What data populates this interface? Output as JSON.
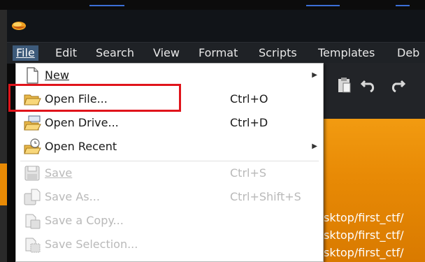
{
  "menubar": {
    "items": [
      {
        "label": "File",
        "active": true
      },
      {
        "label": "Edit"
      },
      {
        "label": "Search"
      },
      {
        "label": "View"
      },
      {
        "label": "Format"
      },
      {
        "label": "Scripts"
      },
      {
        "label": "Templates"
      },
      {
        "label": "Deb"
      }
    ]
  },
  "file_menu": {
    "items": [
      {
        "label": "New",
        "shortcut": "",
        "submenu": true,
        "enabled": true,
        "icon": "new-file-icon"
      },
      {
        "label": "Open File...",
        "shortcut": "Ctrl+O",
        "submenu": false,
        "enabled": true,
        "icon": "open-folder-icon"
      },
      {
        "label": "Open Drive...",
        "shortcut": "Ctrl+D",
        "submenu": false,
        "enabled": true,
        "icon": "open-drive-icon"
      },
      {
        "label": "Open Recent",
        "shortcut": "",
        "submenu": true,
        "enabled": true,
        "icon": "open-recent-icon"
      },
      {
        "label": "Save",
        "shortcut": "Ctrl+S",
        "submenu": false,
        "enabled": false,
        "icon": "save-icon"
      },
      {
        "label": "Save As...",
        "shortcut": "Ctrl+Shift+S",
        "submenu": false,
        "enabled": false,
        "icon": "save-as-icon"
      },
      {
        "label": "Save a Copy...",
        "shortcut": "",
        "submenu": false,
        "enabled": false,
        "icon": "save-copy-icon"
      },
      {
        "label": "Save Selection...",
        "shortcut": "",
        "submenu": false,
        "enabled": false,
        "icon": "save-selection-icon"
      }
    ]
  },
  "background": {
    "paths": [
      "sktop/first_ctf/",
      "sktop/first_ctf/",
      "sktop/first_ctf/"
    ]
  },
  "colors": {
    "highlight_box": "#e0141b",
    "active_menu": "#3d5a7a",
    "orange": "#f29b11"
  }
}
